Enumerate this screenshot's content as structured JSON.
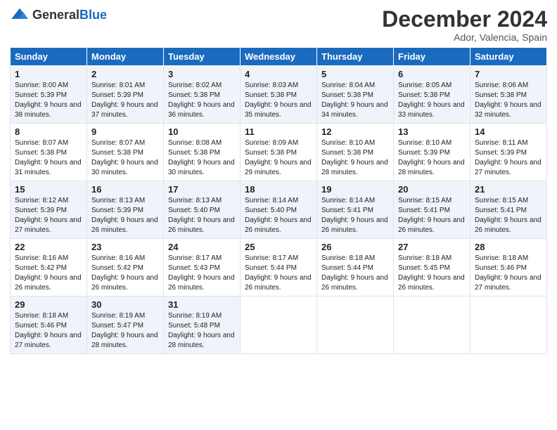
{
  "header": {
    "logo_general": "General",
    "logo_blue": "Blue",
    "month_title": "December 2024",
    "location": "Ador, Valencia, Spain"
  },
  "weekdays": [
    "Sunday",
    "Monday",
    "Tuesday",
    "Wednesday",
    "Thursday",
    "Friday",
    "Saturday"
  ],
  "weeks": [
    [
      {
        "day": "1",
        "sunrise": "8:00 AM",
        "sunset": "5:39 PM",
        "daylight": "9 hours and 38 minutes."
      },
      {
        "day": "2",
        "sunrise": "8:01 AM",
        "sunset": "5:39 PM",
        "daylight": "9 hours and 37 minutes."
      },
      {
        "day": "3",
        "sunrise": "8:02 AM",
        "sunset": "5:38 PM",
        "daylight": "9 hours and 36 minutes."
      },
      {
        "day": "4",
        "sunrise": "8:03 AM",
        "sunset": "5:38 PM",
        "daylight": "9 hours and 35 minutes."
      },
      {
        "day": "5",
        "sunrise": "8:04 AM",
        "sunset": "5:38 PM",
        "daylight": "9 hours and 34 minutes."
      },
      {
        "day": "6",
        "sunrise": "8:05 AM",
        "sunset": "5:38 PM",
        "daylight": "9 hours and 33 minutes."
      },
      {
        "day": "7",
        "sunrise": "8:06 AM",
        "sunset": "5:38 PM",
        "daylight": "9 hours and 32 minutes."
      }
    ],
    [
      {
        "day": "8",
        "sunrise": "8:07 AM",
        "sunset": "5:38 PM",
        "daylight": "9 hours and 31 minutes."
      },
      {
        "day": "9",
        "sunrise": "8:07 AM",
        "sunset": "5:38 PM",
        "daylight": "9 hours and 30 minutes."
      },
      {
        "day": "10",
        "sunrise": "8:08 AM",
        "sunset": "5:38 PM",
        "daylight": "9 hours and 30 minutes."
      },
      {
        "day": "11",
        "sunrise": "8:09 AM",
        "sunset": "5:38 PM",
        "daylight": "9 hours and 29 minutes."
      },
      {
        "day": "12",
        "sunrise": "8:10 AM",
        "sunset": "5:38 PM",
        "daylight": "9 hours and 28 minutes."
      },
      {
        "day": "13",
        "sunrise": "8:10 AM",
        "sunset": "5:39 PM",
        "daylight": "9 hours and 28 minutes."
      },
      {
        "day": "14",
        "sunrise": "8:11 AM",
        "sunset": "5:39 PM",
        "daylight": "9 hours and 27 minutes."
      }
    ],
    [
      {
        "day": "15",
        "sunrise": "8:12 AM",
        "sunset": "5:39 PM",
        "daylight": "9 hours and 27 minutes."
      },
      {
        "day": "16",
        "sunrise": "8:13 AM",
        "sunset": "5:39 PM",
        "daylight": "9 hours and 26 minutes."
      },
      {
        "day": "17",
        "sunrise": "8:13 AM",
        "sunset": "5:40 PM",
        "daylight": "9 hours and 26 minutes."
      },
      {
        "day": "18",
        "sunrise": "8:14 AM",
        "sunset": "5:40 PM",
        "daylight": "9 hours and 26 minutes."
      },
      {
        "day": "19",
        "sunrise": "8:14 AM",
        "sunset": "5:41 PM",
        "daylight": "9 hours and 26 minutes."
      },
      {
        "day": "20",
        "sunrise": "8:15 AM",
        "sunset": "5:41 PM",
        "daylight": "9 hours and 26 minutes."
      },
      {
        "day": "21",
        "sunrise": "8:15 AM",
        "sunset": "5:41 PM",
        "daylight": "9 hours and 26 minutes."
      }
    ],
    [
      {
        "day": "22",
        "sunrise": "8:16 AM",
        "sunset": "5:42 PM",
        "daylight": "9 hours and 26 minutes."
      },
      {
        "day": "23",
        "sunrise": "8:16 AM",
        "sunset": "5:42 PM",
        "daylight": "9 hours and 26 minutes."
      },
      {
        "day": "24",
        "sunrise": "8:17 AM",
        "sunset": "5:43 PM",
        "daylight": "9 hours and 26 minutes."
      },
      {
        "day": "25",
        "sunrise": "8:17 AM",
        "sunset": "5:44 PM",
        "daylight": "9 hours and 26 minutes."
      },
      {
        "day": "26",
        "sunrise": "8:18 AM",
        "sunset": "5:44 PM",
        "daylight": "9 hours and 26 minutes."
      },
      {
        "day": "27",
        "sunrise": "8:18 AM",
        "sunset": "5:45 PM",
        "daylight": "9 hours and 26 minutes."
      },
      {
        "day": "28",
        "sunrise": "8:18 AM",
        "sunset": "5:46 PM",
        "daylight": "9 hours and 27 minutes."
      }
    ],
    [
      {
        "day": "29",
        "sunrise": "8:18 AM",
        "sunset": "5:46 PM",
        "daylight": "9 hours and 27 minutes."
      },
      {
        "day": "30",
        "sunrise": "8:19 AM",
        "sunset": "5:47 PM",
        "daylight": "9 hours and 28 minutes."
      },
      {
        "day": "31",
        "sunrise": "8:19 AM",
        "sunset": "5:48 PM",
        "daylight": "9 hours and 28 minutes."
      },
      null,
      null,
      null,
      null
    ]
  ]
}
